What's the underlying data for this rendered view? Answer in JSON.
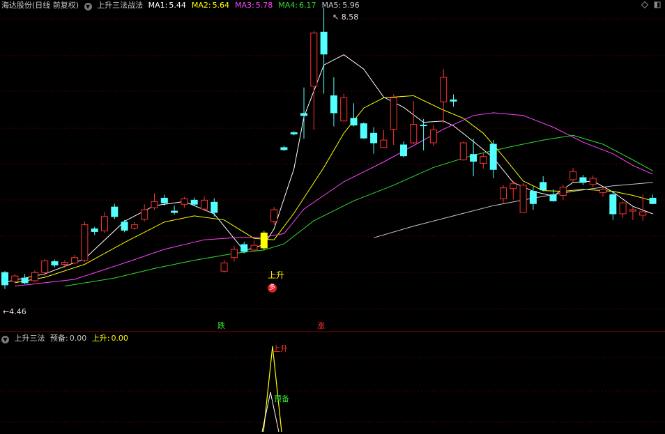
{
  "main_header": {
    "stock_title": "海达股份(日线 前复权)",
    "indicator_name": "上升三法战法",
    "ma": [
      {
        "label": "MA1:",
        "value": "5.44",
        "color": "#ffffff"
      },
      {
        "label": "MA2:",
        "value": "5.64",
        "color": "#ffff00"
      },
      {
        "label": "MA3:",
        "value": "5.78",
        "color": "#ff44ff"
      },
      {
        "label": "MA4:",
        "value": "6.17",
        "color": "#33dd33"
      },
      {
        "label": "MA5:",
        "value": "5.96",
        "color": "#c8c8c8"
      }
    ]
  },
  "window_controls": {
    "diamond_icon": "diamond-icon",
    "restore_icon": "restore-icon"
  },
  "annotations": {
    "high_price": "8.58",
    "low_price": "4.46",
    "signal_up": "上升",
    "signal_duo": "多",
    "marker_die": "跌",
    "marker_zhang": "涨"
  },
  "sub_header": {
    "indicator_name": "上升三法",
    "ready_label": "预备:",
    "ready_value": "0.00",
    "rise_label": "上升:",
    "rise_value": "0.00"
  },
  "sub_annotations": {
    "rise": "上升",
    "ready": "预备"
  },
  "colors": {
    "up": "#ff3232",
    "down": "#54ffff",
    "signal": "#ffff00",
    "grid": "#7a0000",
    "separator": "#8a0000"
  },
  "chart_data": {
    "type": "candlestick",
    "y_range_approx": [
      4.3,
      8.8
    ],
    "candles": [
      [
        4.7,
        4.52,
        4.72,
        4.46
      ],
      [
        4.57,
        4.65,
        4.68,
        4.55
      ],
      [
        4.62,
        4.55,
        4.68,
        4.53
      ],
      [
        4.58,
        4.7,
        4.73,
        4.56
      ],
      [
        4.7,
        4.87,
        4.9,
        4.65
      ],
      [
        4.86,
        4.81,
        4.89,
        4.78
      ],
      [
        4.82,
        4.85,
        4.88,
        4.77
      ],
      [
        4.84,
        4.92,
        4.96,
        4.82
      ],
      [
        4.88,
        5.4,
        5.45,
        4.85
      ],
      [
        5.34,
        5.3,
        5.37,
        5.25
      ],
      [
        5.31,
        5.52,
        5.59,
        5.28
      ],
      [
        5.66,
        5.52,
        5.71,
        5.48
      ],
      [
        5.44,
        5.32,
        5.47,
        5.29
      ],
      [
        5.35,
        5.4,
        5.44,
        5.33
      ],
      [
        5.48,
        5.62,
        5.7,
        5.45
      ],
      [
        5.65,
        5.74,
        5.86,
        5.62
      ],
      [
        5.79,
        5.72,
        5.84,
        5.68
      ],
      [
        5.6,
        5.58,
        5.68,
        5.55
      ],
      [
        5.7,
        5.78,
        5.81,
        5.65
      ],
      [
        5.76,
        5.7,
        5.8,
        5.67
      ],
      [
        5.63,
        5.76,
        5.81,
        5.6
      ],
      [
        5.73,
        5.58,
        5.79,
        5.52
      ],
      [
        4.72,
        4.84,
        4.88,
        4.7
      ],
      [
        4.92,
        5.04,
        5.09,
        4.86
      ],
      [
        5.11,
        5.01,
        5.15,
        4.98
      ],
      [
        5.03,
        5.1,
        5.17,
        5.0
      ],
      [
        5.06,
        5.28,
        5.31,
        5.03
      ],
      [
        5.45,
        5.62,
        5.66,
        5.4
      ],
      [
        6.53,
        6.5,
        6.56,
        6.48
      ],
      [
        6.75,
        6.73,
        6.77,
        6.71
      ],
      [
        7.03,
        7.0,
        7.41,
        6.66
      ],
      [
        7.43,
        8.21,
        8.24,
        6.79
      ],
      [
        8.22,
        7.9,
        8.58,
        7.32
      ],
      [
        7.29,
        7.04,
        7.56,
        6.84
      ],
      [
        6.92,
        7.26,
        7.32,
        6.91
      ],
      [
        6.96,
        6.86,
        7.18,
        6.84
      ],
      [
        6.88,
        6.67,
        6.9,
        6.66
      ],
      [
        6.74,
        6.6,
        6.83,
        6.44
      ],
      [
        6.53,
        6.64,
        6.79,
        6.53
      ],
      [
        6.8,
        7.26,
        7.31,
        6.57
      ],
      [
        6.57,
        6.41,
        6.62,
        6.39
      ],
      [
        6.6,
        6.87,
        7.21,
        6.58
      ],
      [
        6.86,
        6.85,
        6.95,
        6.49
      ],
      [
        6.6,
        6.79,
        6.86,
        6.55
      ],
      [
        7.2,
        7.56,
        7.68,
        6.89
      ],
      [
        7.23,
        7.21,
        7.31,
        7.13
      ],
      [
        6.35,
        6.6,
        6.62,
        6.34
      ],
      [
        6.43,
        6.33,
        6.66,
        6.11
      ],
      [
        6.3,
        6.4,
        6.46,
        6.22
      ],
      [
        6.58,
        6.21,
        6.64,
        6.08
      ],
      [
        5.78,
        5.94,
        5.98,
        5.72
      ],
      [
        5.93,
        6.0,
        6.04,
        5.77
      ],
      [
        5.58,
        5.98,
        6.01,
        5.6
      ],
      [
        5.89,
        5.71,
        5.96,
        5.62
      ],
      [
        6.02,
        5.91,
        6.11,
        5.89
      ],
      [
        5.84,
        5.75,
        5.92,
        5.74
      ],
      [
        5.83,
        5.95,
        5.99,
        5.76
      ],
      [
        6.06,
        6.18,
        6.23,
        6.03
      ],
      [
        6.09,
        6.02,
        6.13,
        5.98
      ],
      [
        5.99,
        6.08,
        6.12,
        5.95
      ],
      [
        5.87,
        5.92,
        5.95,
        5.81
      ],
      [
        5.84,
        5.56,
        5.88,
        5.47
      ],
      [
        5.56,
        5.72,
        5.74,
        5.5
      ],
      [
        5.6,
        5.62,
        5.66,
        5.47
      ],
      [
        5.54,
        5.59,
        5.84,
        5.46
      ],
      [
        5.79,
        5.71,
        5.84,
        5.7
      ]
    ],
    "ma_series": [
      {
        "name": "MA1",
        "color": "#ffffff",
        "points": [
          [
            1,
            4.56
          ],
          [
            5,
            4.68
          ],
          [
            9,
            4.9
          ],
          [
            13,
            5.45
          ],
          [
            16,
            5.68
          ],
          [
            19,
            5.74
          ],
          [
            22,
            5.56
          ],
          [
            25,
            5.02
          ],
          [
            27,
            5.11
          ],
          [
            28,
            5.34
          ],
          [
            30,
            6.22
          ],
          [
            31,
            6.98
          ],
          [
            33,
            7.74
          ],
          [
            35,
            7.89
          ],
          [
            37,
            7.68
          ],
          [
            39,
            7.27
          ],
          [
            41,
            7.12
          ],
          [
            43,
            6.9
          ],
          [
            45,
            6.92
          ],
          [
            46,
            6.85
          ],
          [
            48,
            6.62
          ],
          [
            50,
            6.38
          ],
          [
            52,
            6.02
          ],
          [
            54,
            5.89
          ],
          [
            56,
            5.82
          ],
          [
            58,
            6.02
          ],
          [
            60,
            6.04
          ],
          [
            62,
            5.88
          ],
          [
            64,
            5.67
          ],
          [
            66,
            5.56
          ]
        ]
      },
      {
        "name": "MA2",
        "color": "#ffff00",
        "points": [
          [
            2,
            4.55
          ],
          [
            5,
            4.63
          ],
          [
            9,
            4.82
          ],
          [
            13,
            5.14
          ],
          [
            17,
            5.44
          ],
          [
            20,
            5.53
          ],
          [
            23,
            5.47
          ],
          [
            26,
            5.2
          ],
          [
            28,
            5.18
          ],
          [
            30,
            5.57
          ],
          [
            33,
            6.24
          ],
          [
            35,
            6.74
          ],
          [
            37,
            7.11
          ],
          [
            39,
            7.26
          ],
          [
            42,
            7.29
          ],
          [
            45,
            7.08
          ],
          [
            47,
            6.96
          ],
          [
            49,
            6.74
          ],
          [
            51,
            6.4
          ],
          [
            53,
            6.04
          ],
          [
            55,
            5.9
          ],
          [
            57,
            5.89
          ],
          [
            59,
            5.92
          ],
          [
            62,
            5.89
          ],
          [
            64,
            5.83
          ],
          [
            66,
            5.75
          ]
        ]
      },
      {
        "name": "MA3",
        "color": "#ff44ff",
        "points": [
          [
            2,
            4.5
          ],
          [
            8,
            4.6
          ],
          [
            13,
            4.84
          ],
          [
            17,
            5.04
          ],
          [
            21,
            5.18
          ],
          [
            24,
            5.21
          ],
          [
            27,
            5.22
          ],
          [
            29,
            5.27
          ],
          [
            31,
            5.63
          ],
          [
            35,
            6.03
          ],
          [
            39,
            6.32
          ],
          [
            42,
            6.56
          ],
          [
            45,
            6.8
          ],
          [
            48,
            7.0
          ],
          [
            50,
            7.04
          ],
          [
            53,
            7.0
          ],
          [
            56,
            6.83
          ],
          [
            59,
            6.61
          ],
          [
            62,
            6.44
          ],
          [
            64,
            6.27
          ],
          [
            66,
            6.14
          ]
        ]
      },
      {
        "name": "MA4",
        "color": "#33dd33",
        "points": [
          [
            7,
            4.5
          ],
          [
            12,
            4.62
          ],
          [
            16,
            4.76
          ],
          [
            20,
            4.88
          ],
          [
            24,
            4.98
          ],
          [
            27,
            5.03
          ],
          [
            29,
            5.12
          ],
          [
            32,
            5.46
          ],
          [
            36,
            5.75
          ],
          [
            40,
            5.98
          ],
          [
            44,
            6.24
          ],
          [
            48,
            6.42
          ],
          [
            52,
            6.55
          ],
          [
            55,
            6.64
          ],
          [
            58,
            6.71
          ],
          [
            61,
            6.58
          ],
          [
            64,
            6.35
          ],
          [
            66,
            6.19
          ]
        ]
      },
      {
        "name": "MA5",
        "color": "#c8c8c8",
        "points": [
          [
            38,
            5.21
          ],
          [
            42,
            5.38
          ],
          [
            46,
            5.53
          ],
          [
            50,
            5.68
          ],
          [
            54,
            5.79
          ],
          [
            58,
            5.89
          ],
          [
            62,
            5.97
          ],
          [
            66,
            6.02
          ]
        ]
      }
    ],
    "signal_bar_index": 27,
    "sub_indicator": {
      "name": "上升三法",
      "series": [
        {
          "name": "预备",
          "values": [
            0,
            0,
            1,
            0,
            0
          ]
        },
        {
          "name": "上升",
          "values": [
            0,
            0,
            1,
            0,
            0
          ]
        }
      ]
    }
  }
}
